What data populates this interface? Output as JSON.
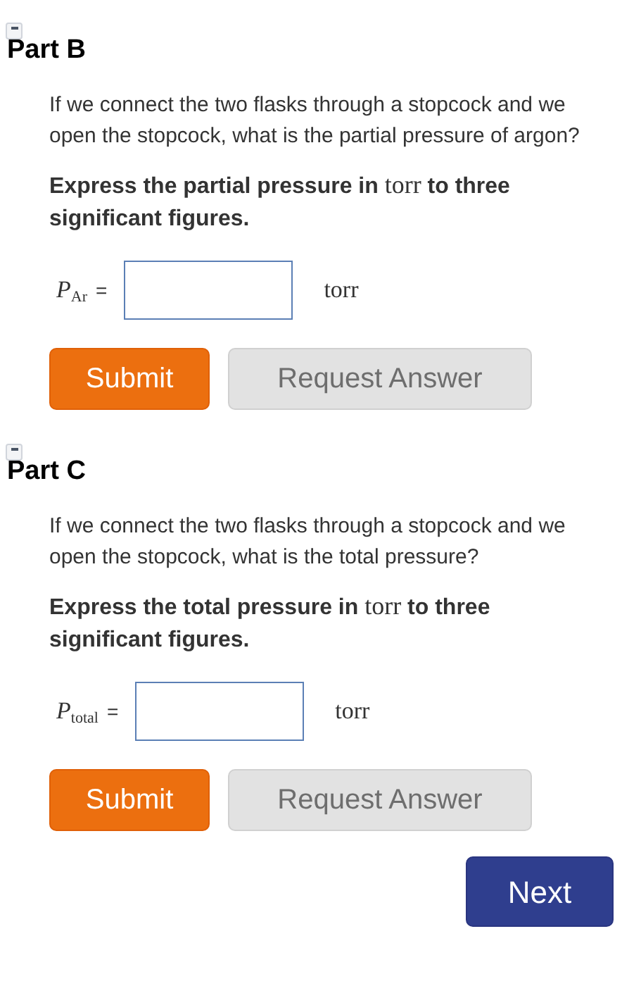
{
  "parts": [
    {
      "title": "Part B",
      "expanded": true,
      "question": "If we connect the two flasks through a stopcock and we open the stopcock, what is the partial pressure of argon?",
      "instruction_before": "Express the partial pressure in",
      "instruction_unit": "torr",
      "instruction_after": "to three significant figures.",
      "symbol": "P",
      "subscript": "Ar",
      "equals": "=",
      "unit": "torr",
      "buttons": [
        {
          "label": "Submit",
          "kind": "primary",
          "disabled": false
        },
        {
          "label": "Request Answer",
          "kind": "secondary",
          "disabled": true
        }
      ]
    },
    {
      "title": "Part C",
      "expanded": true,
      "question": "If we connect the two flasks through a stopcock and we open the stopcock, what is the total pressure?",
      "instruction_before": "Express the total pressure in",
      "instruction_unit": "torr",
      "instruction_after": "to three significant figures.",
      "symbol": "P",
      "subscript": "total",
      "equals": "=",
      "unit": "torr",
      "buttons": [
        {
          "label": "Submit",
          "kind": "primary",
          "disabled": false
        },
        {
          "label": "Request Answer",
          "kind": "secondary",
          "disabled": true
        }
      ]
    }
  ],
  "next_button": "Next"
}
